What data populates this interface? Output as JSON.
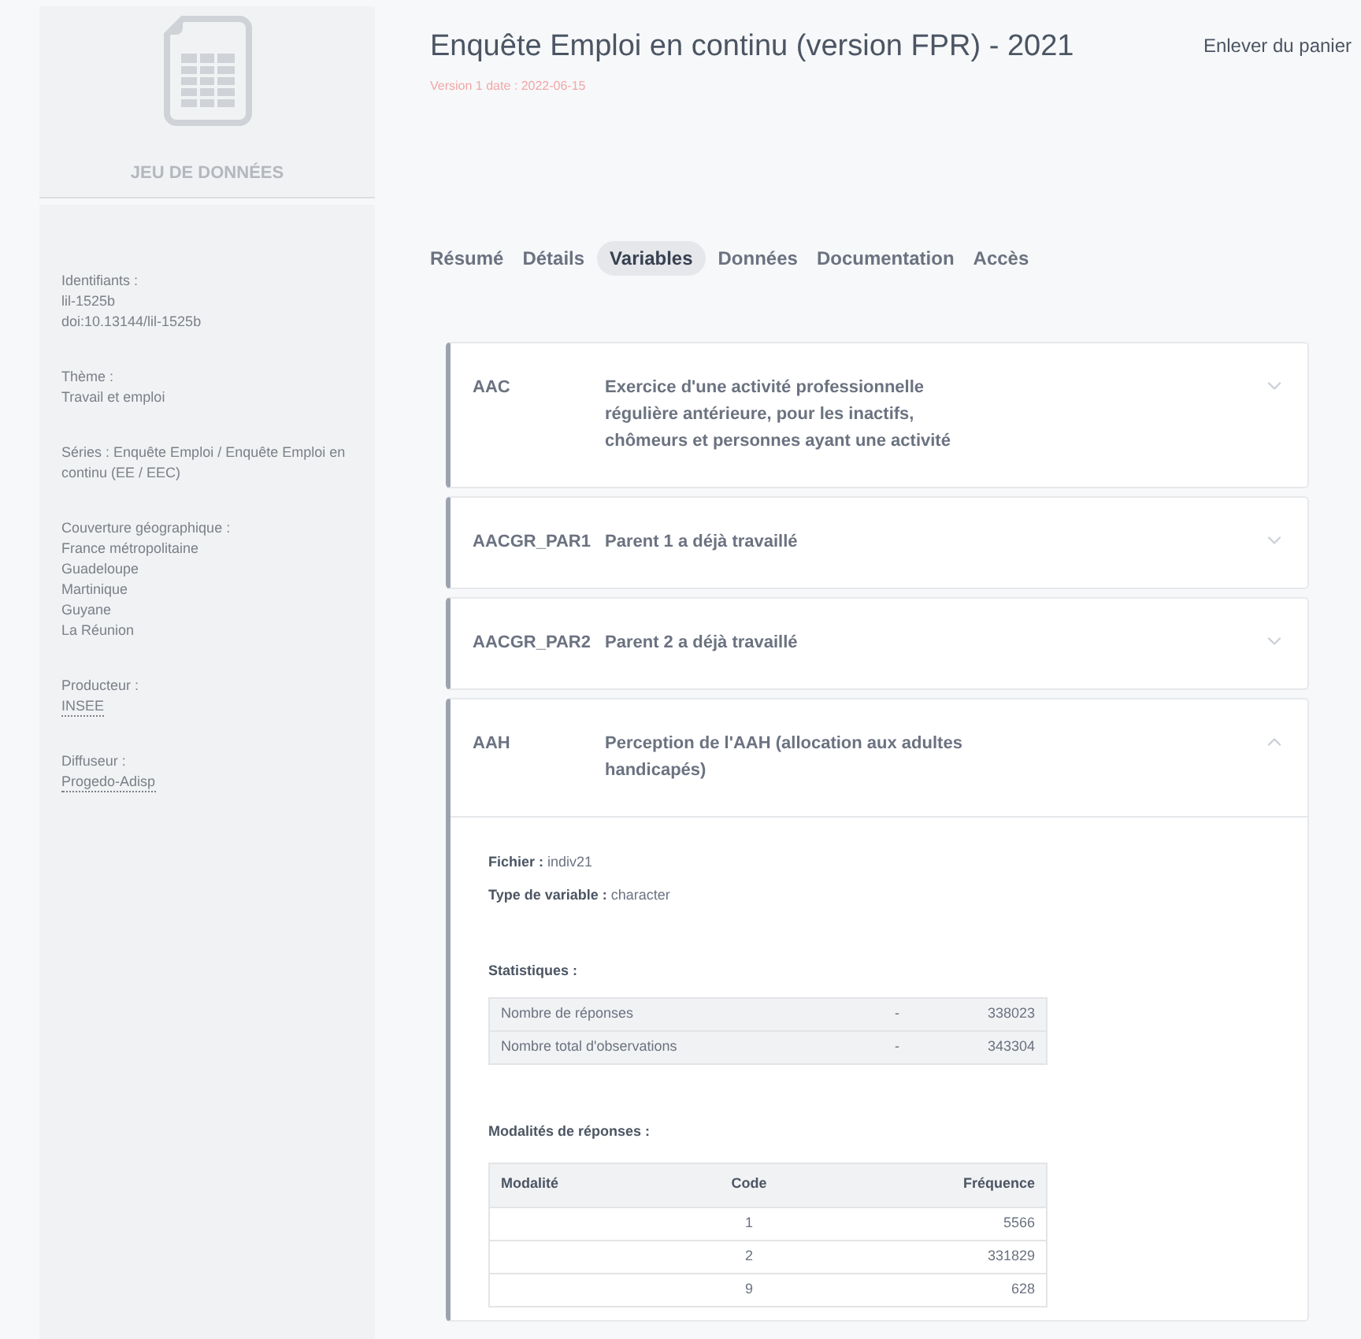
{
  "sidebar": {
    "category": "JEU DE DONNÉES",
    "sections": [
      {
        "kind": "block",
        "label": "Identifiants :",
        "values": [
          {
            "text": "lil-1525b",
            "link": false
          },
          {
            "text": "doi:10.13144/lil-1525b",
            "link": false
          }
        ]
      },
      {
        "kind": "block",
        "label": "Thème :",
        "values": [
          {
            "text": "Travail et emploi",
            "link": false
          }
        ]
      },
      {
        "kind": "inline",
        "label": "Séries :",
        "values": [
          {
            "text": "Enquête Emploi / Enquête Emploi en continu (EE / EEC)",
            "link": false
          }
        ]
      },
      {
        "kind": "block",
        "label": "Couverture géographique :",
        "values": [
          {
            "text": "France métropolitaine",
            "link": false
          },
          {
            "text": "Guadeloupe",
            "link": false
          },
          {
            "text": "Martinique",
            "link": false
          },
          {
            "text": "Guyane",
            "link": false
          },
          {
            "text": "La Réunion",
            "link": false
          }
        ]
      },
      {
        "kind": "block",
        "label": "Producteur :",
        "values": [
          {
            "text": "INSEE",
            "link": true
          }
        ]
      },
      {
        "kind": "block",
        "label": "Diffuseur :",
        "values": [
          {
            "text": "Progedo-Adisp",
            "link": true
          }
        ]
      }
    ]
  },
  "header": {
    "title": "Enquête Emploi en continu (version FPR) - 2021",
    "version": "Version 1 date : 2022-06-15",
    "cart_action": "Enlever du panier"
  },
  "tabs": [
    {
      "label": "Résumé",
      "selected": false
    },
    {
      "label": "Détails",
      "selected": false
    },
    {
      "label": "Variables",
      "selected": true
    },
    {
      "label": "Données",
      "selected": false
    },
    {
      "label": "Documentation",
      "selected": false
    },
    {
      "label": "Accès",
      "selected": false
    }
  ],
  "variables": [
    {
      "code": "AAC",
      "label": "Exercice d'une activité professionnelle régulière antérieure, pour les inactifs, chômeurs et personnes ayant une activité",
      "expanded": false
    },
    {
      "code": "AACGR_PAR1",
      "label": "Parent 1 a déjà travaillé",
      "expanded": false
    },
    {
      "code": "AACGR_PAR2",
      "label": "Parent 2 a déjà travaillé",
      "expanded": false
    },
    {
      "code": "AAH",
      "label": "Perception de l'AAH (allocation aux adultes handicapés)",
      "expanded": true,
      "details": {
        "fields": [
          {
            "label": "Fichier :",
            "value": "indiv21"
          },
          {
            "label": "Type de variable :",
            "value": "character"
          }
        ],
        "stats_title": "Statistiques :",
        "stats": [
          {
            "label": "Nombre de réponses",
            "dash": "-",
            "value": "338023"
          },
          {
            "label": "Nombre total d'observations",
            "dash": "-",
            "value": "343304"
          }
        ],
        "modalities_title": "Modalités de réponses :",
        "modalities_columns": [
          "Modalité",
          "Code",
          "Fréquence"
        ],
        "modalities_rows": [
          {
            "code": "1",
            "frequency": "5566"
          },
          {
            "code": "2",
            "frequency": "331829"
          },
          {
            "code": "9",
            "frequency": "628"
          }
        ]
      }
    }
  ]
}
